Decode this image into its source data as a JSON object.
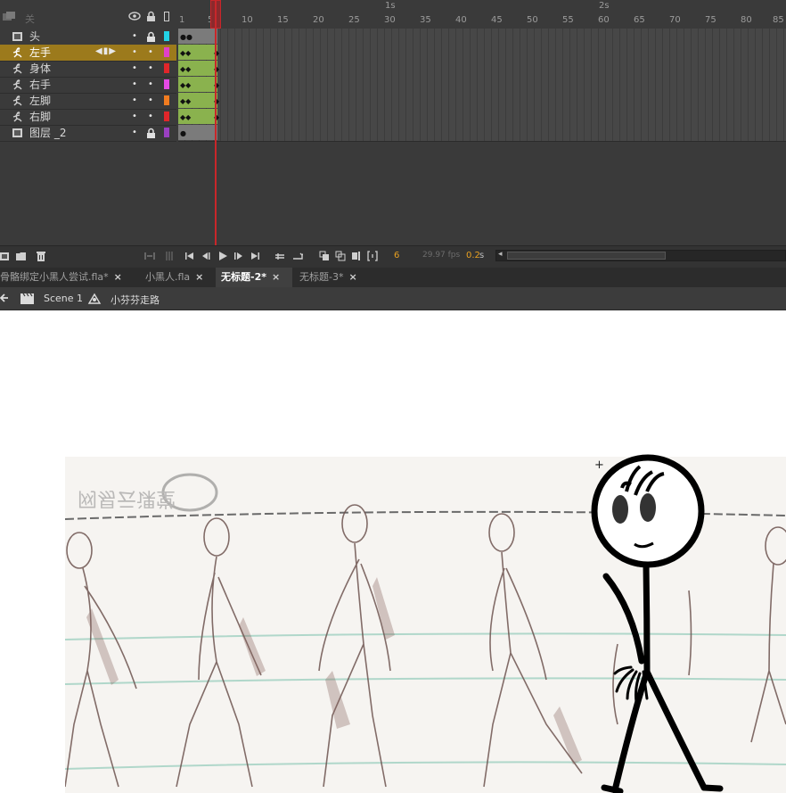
{
  "timeline": {
    "layer_header_name": "关",
    "layers": [
      {
        "name": "头",
        "type": "folder",
        "color": "#22d3e6",
        "locked": true,
        "selected": false
      },
      {
        "name": "左手",
        "type": "bone",
        "color": "#e040c8",
        "locked": false,
        "selected": true
      },
      {
        "name": "身体",
        "type": "bone",
        "color": "#e0262a",
        "locked": false,
        "selected": false
      },
      {
        "name": "右手",
        "type": "bone",
        "color": "#e64ae6",
        "locked": false,
        "selected": false
      },
      {
        "name": "左脚",
        "type": "bone",
        "color": "#f07c20",
        "locked": false,
        "selected": false
      },
      {
        "name": "右脚",
        "type": "bone",
        "color": "#e0262a",
        "locked": false,
        "selected": false
      },
      {
        "name": "图层 _2",
        "type": "folder",
        "color": "#9a40c0",
        "locked": true,
        "selected": false
      }
    ],
    "ruler_numbers": [
      "1",
      "5",
      "10",
      "15",
      "20",
      "25",
      "30",
      "35",
      "40",
      "45",
      "50",
      "55",
      "60",
      "65",
      "70",
      "75",
      "80",
      "85"
    ],
    "ruler_seconds": [
      "1s",
      "2s"
    ],
    "current_frame": "6",
    "fps": "29.97 fps",
    "elapsed": "0.2",
    "elapsed_unit": "s"
  },
  "document_tabs": [
    {
      "label": "骨骼绑定小黑人尝试.fla*",
      "active": false
    },
    {
      "label": "小黑人.fla",
      "active": false
    },
    {
      "label": "无标题-2*",
      "active": true
    },
    {
      "label": "无标题-3*",
      "active": false
    }
  ],
  "close_glyph": "×",
  "breadcrumb": {
    "scene": "Scene 1",
    "symbol": "小芬芬走路"
  },
  "stage": {
    "reference_watermark": "网易云课堂",
    "cursor_glyph": "+"
  },
  "colors": {
    "panel_bg": "#3a3a3a",
    "selected_layer": "#9c7a1c",
    "tween_span": "#8ab24e",
    "playhead": "#c8262a",
    "accent_orange": "#e8a020"
  }
}
